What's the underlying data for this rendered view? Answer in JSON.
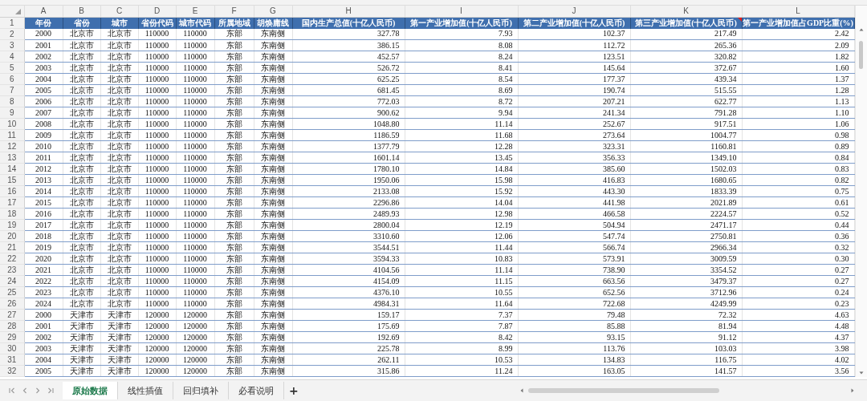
{
  "columns": [
    {
      "letter": "A",
      "header": "年份",
      "comment": false
    },
    {
      "letter": "B",
      "header": "省份",
      "comment": false
    },
    {
      "letter": "C",
      "header": "城市",
      "comment": false
    },
    {
      "letter": "D",
      "header": "省份代码",
      "comment": false
    },
    {
      "letter": "E",
      "header": "城市代码",
      "comment": false
    },
    {
      "letter": "F",
      "header": "所属地域",
      "comment": false
    },
    {
      "letter": "G",
      "header": "胡焕庸线",
      "comment": false
    },
    {
      "letter": "H",
      "header": "国内生产总值(十亿人民币)",
      "comment": false
    },
    {
      "letter": "I",
      "header": "第一产业增加值(十亿人民币)",
      "comment": false
    },
    {
      "letter": "J",
      "header": "第二产业增加值(十亿人民币)",
      "comment": false
    },
    {
      "letter": "K",
      "header": "第三产业增加值(十亿人民币)",
      "comment": true
    },
    {
      "letter": "L",
      "header": "第一产业增加值占GDP比重(%)",
      "comment": false
    }
  ],
  "header_row_number": "1",
  "rows": [
    {
      "number": "2",
      "cells": [
        "2000",
        "北京市",
        "北京市",
        "110000",
        "110000",
        "东部",
        "东南侧",
        "327.78",
        "7.93",
        "102.37",
        "217.49",
        "2.42"
      ]
    },
    {
      "number": "3",
      "cells": [
        "2001",
        "北京市",
        "北京市",
        "110000",
        "110000",
        "东部",
        "东南侧",
        "386.15",
        "8.08",
        "112.72",
        "265.36",
        "2.09"
      ]
    },
    {
      "number": "4",
      "cells": [
        "2002",
        "北京市",
        "北京市",
        "110000",
        "110000",
        "东部",
        "东南侧",
        "452.57",
        "8.24",
        "123.51",
        "320.82",
        "1.82"
      ]
    },
    {
      "number": "5",
      "cells": [
        "2003",
        "北京市",
        "北京市",
        "110000",
        "110000",
        "东部",
        "东南侧",
        "526.72",
        "8.41",
        "145.64",
        "372.67",
        "1.60"
      ]
    },
    {
      "number": "6",
      "cells": [
        "2004",
        "北京市",
        "北京市",
        "110000",
        "110000",
        "东部",
        "东南侧",
        "625.25",
        "8.54",
        "177.37",
        "439.34",
        "1.37"
      ]
    },
    {
      "number": "7",
      "cells": [
        "2005",
        "北京市",
        "北京市",
        "110000",
        "110000",
        "东部",
        "东南侧",
        "681.45",
        "8.69",
        "190.74",
        "515.55",
        "1.28"
      ]
    },
    {
      "number": "8",
      "cells": [
        "2006",
        "北京市",
        "北京市",
        "110000",
        "110000",
        "东部",
        "东南侧",
        "772.03",
        "8.72",
        "207.21",
        "622.77",
        "1.13"
      ]
    },
    {
      "number": "9",
      "cells": [
        "2007",
        "北京市",
        "北京市",
        "110000",
        "110000",
        "东部",
        "东南侧",
        "900.62",
        "9.94",
        "241.34",
        "791.28",
        "1.10"
      ]
    },
    {
      "number": "10",
      "cells": [
        "2008",
        "北京市",
        "北京市",
        "110000",
        "110000",
        "东部",
        "东南侧",
        "1048.80",
        "11.14",
        "252.67",
        "917.51",
        "1.06"
      ]
    },
    {
      "number": "11",
      "cells": [
        "2009",
        "北京市",
        "北京市",
        "110000",
        "110000",
        "东部",
        "东南侧",
        "1186.59",
        "11.68",
        "273.64",
        "1004.77",
        "0.98"
      ]
    },
    {
      "number": "12",
      "cells": [
        "2010",
        "北京市",
        "北京市",
        "110000",
        "110000",
        "东部",
        "东南侧",
        "1377.79",
        "12.28",
        "323.31",
        "1160.81",
        "0.89"
      ]
    },
    {
      "number": "13",
      "cells": [
        "2011",
        "北京市",
        "北京市",
        "110000",
        "110000",
        "东部",
        "东南侧",
        "1601.14",
        "13.45",
        "356.33",
        "1349.10",
        "0.84"
      ]
    },
    {
      "number": "14",
      "cells": [
        "2012",
        "北京市",
        "北京市",
        "110000",
        "110000",
        "东部",
        "东南侧",
        "1780.10",
        "14.84",
        "385.60",
        "1502.03",
        "0.83"
      ]
    },
    {
      "number": "15",
      "cells": [
        "2013",
        "北京市",
        "北京市",
        "110000",
        "110000",
        "东部",
        "东南侧",
        "1950.06",
        "15.98",
        "416.83",
        "1680.65",
        "0.82"
      ]
    },
    {
      "number": "16",
      "cells": [
        "2014",
        "北京市",
        "北京市",
        "110000",
        "110000",
        "东部",
        "东南侧",
        "2133.08",
        "15.92",
        "443.30",
        "1833.39",
        "0.75"
      ]
    },
    {
      "number": "17",
      "cells": [
        "2015",
        "北京市",
        "北京市",
        "110000",
        "110000",
        "东部",
        "东南侧",
        "2296.86",
        "14.04",
        "441.98",
        "2021.89",
        "0.61"
      ]
    },
    {
      "number": "18",
      "cells": [
        "2016",
        "北京市",
        "北京市",
        "110000",
        "110000",
        "东部",
        "东南侧",
        "2489.93",
        "12.98",
        "466.58",
        "2224.57",
        "0.52"
      ]
    },
    {
      "number": "19",
      "cells": [
        "2017",
        "北京市",
        "北京市",
        "110000",
        "110000",
        "东部",
        "东南侧",
        "2800.04",
        "12.19",
        "504.94",
        "2471.17",
        "0.44"
      ]
    },
    {
      "number": "20",
      "cells": [
        "2018",
        "北京市",
        "北京市",
        "110000",
        "110000",
        "东部",
        "东南侧",
        "3310.60",
        "12.06",
        "547.74",
        "2750.81",
        "0.36"
      ]
    },
    {
      "number": "21",
      "cells": [
        "2019",
        "北京市",
        "北京市",
        "110000",
        "110000",
        "东部",
        "东南侧",
        "3544.51",
        "11.44",
        "566.74",
        "2966.34",
        "0.32"
      ]
    },
    {
      "number": "22",
      "cells": [
        "2020",
        "北京市",
        "北京市",
        "110000",
        "110000",
        "东部",
        "东南侧",
        "3594.33",
        "10.83",
        "573.91",
        "3009.59",
        "0.30"
      ]
    },
    {
      "number": "23",
      "cells": [
        "2021",
        "北京市",
        "北京市",
        "110000",
        "110000",
        "东部",
        "东南侧",
        "4104.56",
        "11.14",
        "738.90",
        "3354.52",
        "0.27"
      ]
    },
    {
      "number": "24",
      "cells": [
        "2022",
        "北京市",
        "北京市",
        "110000",
        "110000",
        "东部",
        "东南侧",
        "4154.09",
        "11.15",
        "663.56",
        "3479.37",
        "0.27"
      ]
    },
    {
      "number": "25",
      "cells": [
        "2023",
        "北京市",
        "北京市",
        "110000",
        "110000",
        "东部",
        "东南侧",
        "4376.10",
        "10.55",
        "652.56",
        "3712.96",
        "0.24"
      ]
    },
    {
      "number": "26",
      "cells": [
        "2024",
        "北京市",
        "北京市",
        "110000",
        "110000",
        "东部",
        "东南侧",
        "4984.31",
        "11.64",
        "722.68",
        "4249.99",
        "0.23"
      ]
    },
    {
      "number": "27",
      "cells": [
        "2000",
        "天津市",
        "天津市",
        "120000",
        "120000",
        "东部",
        "东南侧",
        "159.17",
        "7.37",
        "79.48",
        "72.32",
        "4.63"
      ]
    },
    {
      "number": "28",
      "cells": [
        "2001",
        "天津市",
        "天津市",
        "120000",
        "120000",
        "东部",
        "东南侧",
        "175.69",
        "7.87",
        "85.88",
        "81.94",
        "4.48"
      ]
    },
    {
      "number": "29",
      "cells": [
        "2002",
        "天津市",
        "天津市",
        "120000",
        "120000",
        "东部",
        "东南侧",
        "192.69",
        "8.42",
        "93.15",
        "91.12",
        "4.37"
      ]
    },
    {
      "number": "30",
      "cells": [
        "2003",
        "天津市",
        "天津市",
        "120000",
        "120000",
        "东部",
        "东南侧",
        "225.78",
        "8.99",
        "113.76",
        "103.03",
        "3.98"
      ]
    },
    {
      "number": "31",
      "cells": [
        "2004",
        "天津市",
        "天津市",
        "120000",
        "120000",
        "东部",
        "东南侧",
        "262.11",
        "10.53",
        "134.83",
        "116.75",
        "4.02"
      ]
    },
    {
      "number": "32",
      "cells": [
        "2005",
        "天津市",
        "天津市",
        "120000",
        "120000",
        "东部",
        "东南侧",
        "315.86",
        "11.24",
        "163.05",
        "141.57",
        "3.56"
      ]
    }
  ],
  "sheet_tabs": [
    {
      "label": "原始数据",
      "selected": true
    },
    {
      "label": "线性插值",
      "selected": false
    },
    {
      "label": "回归填补",
      "selected": false
    },
    {
      "label": "必看说明",
      "selected": false
    }
  ],
  "add_sheet": "+"
}
